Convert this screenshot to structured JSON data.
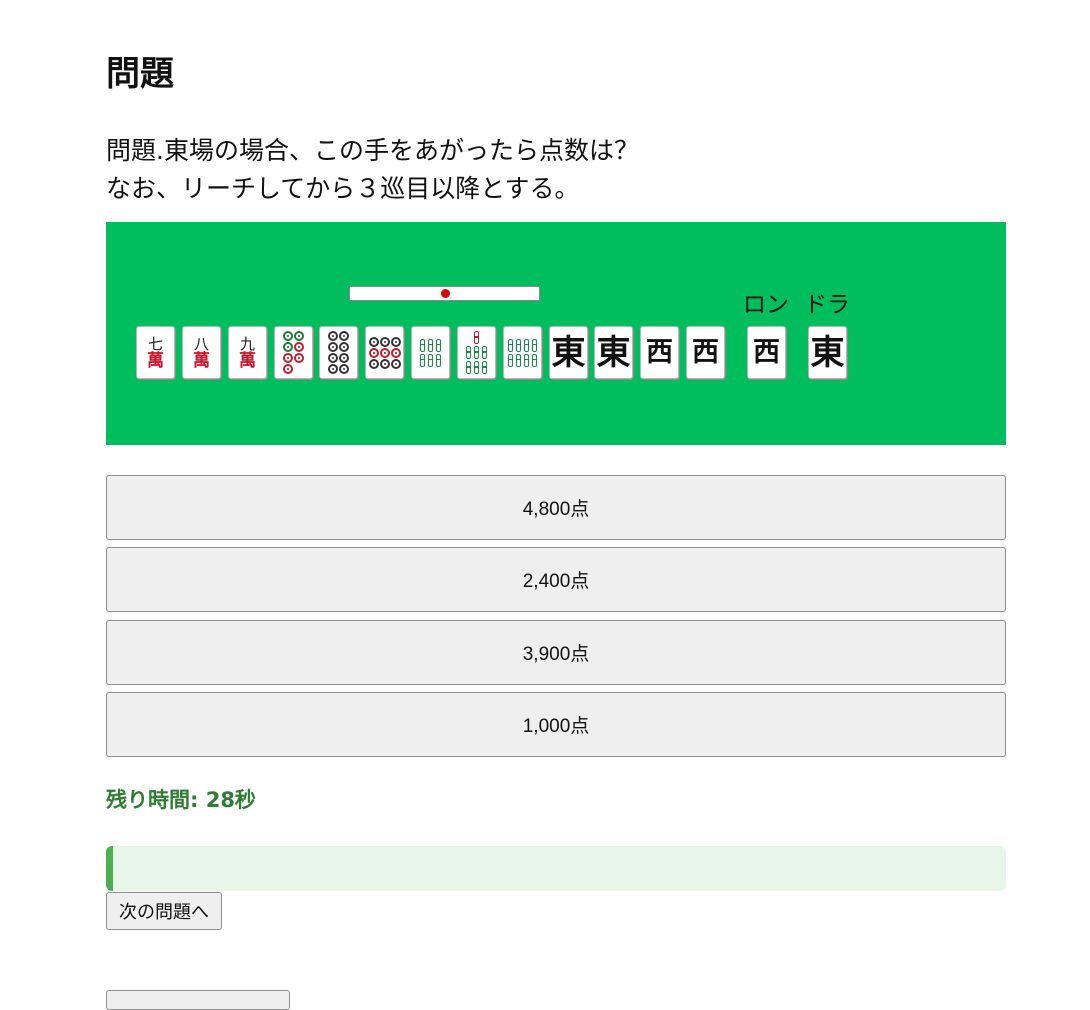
{
  "heading": "問題",
  "question": {
    "line1": "問題.東場の場合、この手をあがったら点数は？",
    "line2": "なお、リーチしてから３巡目以降とする。"
  },
  "board": {
    "background": "#00be5e",
    "ron_label": "ロン",
    "dora_label": "ドラ",
    "riichi_stick_present": true,
    "hand": [
      {
        "suit": "man",
        "rank": "七",
        "suit_char": "萬"
      },
      {
        "suit": "man",
        "rank": "八",
        "suit_char": "萬"
      },
      {
        "suit": "man",
        "rank": "九",
        "suit_char": "萬"
      },
      {
        "suit": "pin",
        "count": 7,
        "name": "7-pin"
      },
      {
        "suit": "pin",
        "count": 8,
        "name": "8-pin"
      },
      {
        "suit": "pin",
        "count": 9,
        "name": "9-pin"
      },
      {
        "suit": "sou",
        "count": 6,
        "name": "6-sou"
      },
      {
        "suit": "sou",
        "count": 7,
        "name": "7-sou"
      },
      {
        "suit": "sou",
        "count": 8,
        "name": "8-sou"
      },
      {
        "suit": "honor",
        "char": "東"
      },
      {
        "suit": "honor",
        "char": "東"
      },
      {
        "suit": "honor",
        "char": "西"
      },
      {
        "suit": "honor",
        "char": "西"
      }
    ],
    "ron_tile": {
      "suit": "honor",
      "char": "西"
    },
    "dora_tile": {
      "suit": "honor",
      "char": "東"
    }
  },
  "choices": [
    "4,800点",
    "2,400点",
    "3,900点",
    "1,000点"
  ],
  "timer": {
    "text": "残り時間: 28秒",
    "remaining_fraction": 0.0
  },
  "next_button": "次の問題へ",
  "colors": {
    "timer": "#2e7d32",
    "progress_bg": "#e8f5e9",
    "progress_fill": "#4caf50"
  }
}
